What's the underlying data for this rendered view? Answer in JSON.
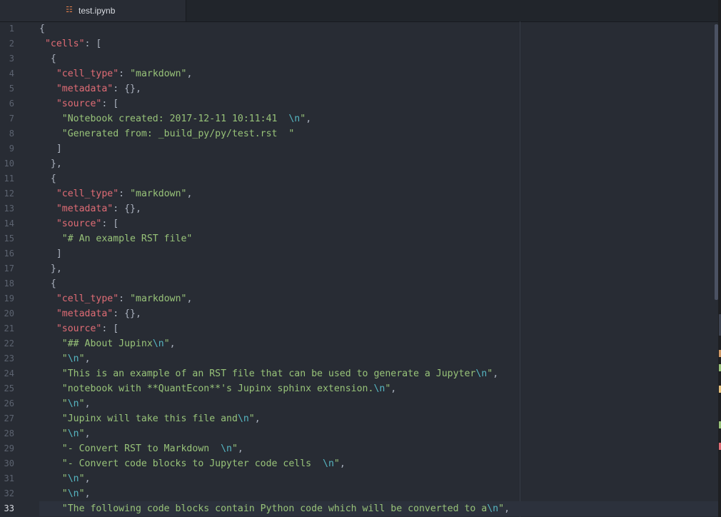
{
  "tab": {
    "title": "test.ipynb",
    "icon": "notebook-file-icon"
  },
  "current_line": 33,
  "lines": [
    {
      "n": "1",
      "tokens": [
        {
          "t": "{",
          "c": "p"
        }
      ]
    },
    {
      "n": "2",
      "tokens": [
        {
          "t": " ",
          "c": "p"
        },
        {
          "t": "\"cells\"",
          "c": "k"
        },
        {
          "t": ": [",
          "c": "p"
        }
      ]
    },
    {
      "n": "3",
      "tokens": [
        {
          "t": "  {",
          "c": "p"
        }
      ]
    },
    {
      "n": "4",
      "tokens": [
        {
          "t": "   ",
          "c": "p"
        },
        {
          "t": "\"cell_type\"",
          "c": "k"
        },
        {
          "t": ": ",
          "c": "p"
        },
        {
          "t": "\"markdown\"",
          "c": "s"
        },
        {
          "t": ",",
          "c": "p"
        }
      ]
    },
    {
      "n": "5",
      "tokens": [
        {
          "t": "   ",
          "c": "p"
        },
        {
          "t": "\"metadata\"",
          "c": "k"
        },
        {
          "t": ": {},",
          "c": "p"
        }
      ]
    },
    {
      "n": "6",
      "tokens": [
        {
          "t": "   ",
          "c": "p"
        },
        {
          "t": "\"source\"",
          "c": "k"
        },
        {
          "t": ": [",
          "c": "p"
        }
      ]
    },
    {
      "n": "7",
      "tokens": [
        {
          "t": "    ",
          "c": "p"
        },
        {
          "t": "\"Notebook created: 2017-12-11 10:11:41  ",
          "c": "s"
        },
        {
          "t": "\\n",
          "c": "e"
        },
        {
          "t": "\"",
          "c": "s"
        },
        {
          "t": ",",
          "c": "p"
        }
      ]
    },
    {
      "n": "8",
      "tokens": [
        {
          "t": "    ",
          "c": "p"
        },
        {
          "t": "\"Generated from: _build_py/py/test.rst  \"",
          "c": "s"
        }
      ]
    },
    {
      "n": "9",
      "tokens": [
        {
          "t": "   ]",
          "c": "p"
        }
      ]
    },
    {
      "n": "10",
      "tokens": [
        {
          "t": "  },",
          "c": "p"
        }
      ]
    },
    {
      "n": "11",
      "tokens": [
        {
          "t": "  {",
          "c": "p"
        }
      ]
    },
    {
      "n": "12",
      "tokens": [
        {
          "t": "   ",
          "c": "p"
        },
        {
          "t": "\"cell_type\"",
          "c": "k"
        },
        {
          "t": ": ",
          "c": "p"
        },
        {
          "t": "\"markdown\"",
          "c": "s"
        },
        {
          "t": ",",
          "c": "p"
        }
      ]
    },
    {
      "n": "13",
      "tokens": [
        {
          "t": "   ",
          "c": "p"
        },
        {
          "t": "\"metadata\"",
          "c": "k"
        },
        {
          "t": ": {},",
          "c": "p"
        }
      ]
    },
    {
      "n": "14",
      "tokens": [
        {
          "t": "   ",
          "c": "p"
        },
        {
          "t": "\"source\"",
          "c": "k"
        },
        {
          "t": ": [",
          "c": "p"
        }
      ]
    },
    {
      "n": "15",
      "tokens": [
        {
          "t": "    ",
          "c": "p"
        },
        {
          "t": "\"# An example RST file\"",
          "c": "s"
        }
      ]
    },
    {
      "n": "16",
      "tokens": [
        {
          "t": "   ]",
          "c": "p"
        }
      ]
    },
    {
      "n": "17",
      "tokens": [
        {
          "t": "  },",
          "c": "p"
        }
      ]
    },
    {
      "n": "18",
      "tokens": [
        {
          "t": "  {",
          "c": "p"
        }
      ]
    },
    {
      "n": "19",
      "tokens": [
        {
          "t": "   ",
          "c": "p"
        },
        {
          "t": "\"cell_type\"",
          "c": "k"
        },
        {
          "t": ": ",
          "c": "p"
        },
        {
          "t": "\"markdown\"",
          "c": "s"
        },
        {
          "t": ",",
          "c": "p"
        }
      ]
    },
    {
      "n": "20",
      "tokens": [
        {
          "t": "   ",
          "c": "p"
        },
        {
          "t": "\"metadata\"",
          "c": "k"
        },
        {
          "t": ": {},",
          "c": "p"
        }
      ]
    },
    {
      "n": "21",
      "tokens": [
        {
          "t": "   ",
          "c": "p"
        },
        {
          "t": "\"source\"",
          "c": "k"
        },
        {
          "t": ": [",
          "c": "p"
        }
      ]
    },
    {
      "n": "22",
      "tokens": [
        {
          "t": "    ",
          "c": "p"
        },
        {
          "t": "\"## About Jupinx",
          "c": "s"
        },
        {
          "t": "\\n",
          "c": "e"
        },
        {
          "t": "\"",
          "c": "s"
        },
        {
          "t": ",",
          "c": "p"
        }
      ]
    },
    {
      "n": "23",
      "tokens": [
        {
          "t": "    ",
          "c": "p"
        },
        {
          "t": "\"",
          "c": "s"
        },
        {
          "t": "\\n",
          "c": "e"
        },
        {
          "t": "\"",
          "c": "s"
        },
        {
          "t": ",",
          "c": "p"
        }
      ]
    },
    {
      "n": "24",
      "tokens": [
        {
          "t": "    ",
          "c": "p"
        },
        {
          "t": "\"This is an example of an RST file that can be used to generate a Jupyter",
          "c": "s"
        },
        {
          "t": "\\n",
          "c": "e"
        },
        {
          "t": "\"",
          "c": "s"
        },
        {
          "t": ",",
          "c": "p"
        }
      ]
    },
    {
      "n": "25",
      "tokens": [
        {
          "t": "    ",
          "c": "p"
        },
        {
          "t": "\"notebook with **QuantEcon**'s Jupinx sphinx extension.",
          "c": "s"
        },
        {
          "t": "\\n",
          "c": "e"
        },
        {
          "t": "\"",
          "c": "s"
        },
        {
          "t": ",",
          "c": "p"
        }
      ]
    },
    {
      "n": "26",
      "tokens": [
        {
          "t": "    ",
          "c": "p"
        },
        {
          "t": "\"",
          "c": "s"
        },
        {
          "t": "\\n",
          "c": "e"
        },
        {
          "t": "\"",
          "c": "s"
        },
        {
          "t": ",",
          "c": "p"
        }
      ]
    },
    {
      "n": "27",
      "tokens": [
        {
          "t": "    ",
          "c": "p"
        },
        {
          "t": "\"Jupinx will take this file and",
          "c": "s"
        },
        {
          "t": "\\n",
          "c": "e"
        },
        {
          "t": "\"",
          "c": "s"
        },
        {
          "t": ",",
          "c": "p"
        }
      ]
    },
    {
      "n": "28",
      "tokens": [
        {
          "t": "    ",
          "c": "p"
        },
        {
          "t": "\"",
          "c": "s"
        },
        {
          "t": "\\n",
          "c": "e"
        },
        {
          "t": "\"",
          "c": "s"
        },
        {
          "t": ",",
          "c": "p"
        }
      ]
    },
    {
      "n": "29",
      "tokens": [
        {
          "t": "    ",
          "c": "p"
        },
        {
          "t": "\"- Convert RST to Markdown  ",
          "c": "s"
        },
        {
          "t": "\\n",
          "c": "e"
        },
        {
          "t": "\"",
          "c": "s"
        },
        {
          "t": ",",
          "c": "p"
        }
      ]
    },
    {
      "n": "30",
      "tokens": [
        {
          "t": "    ",
          "c": "p"
        },
        {
          "t": "\"- Convert code blocks to Jupyter code cells  ",
          "c": "s"
        },
        {
          "t": "\\n",
          "c": "e"
        },
        {
          "t": "\"",
          "c": "s"
        },
        {
          "t": ",",
          "c": "p"
        }
      ]
    },
    {
      "n": "31",
      "tokens": [
        {
          "t": "    ",
          "c": "p"
        },
        {
          "t": "\"",
          "c": "s"
        },
        {
          "t": "\\n",
          "c": "e"
        },
        {
          "t": "\"",
          "c": "s"
        },
        {
          "t": ",",
          "c": "p"
        }
      ]
    },
    {
      "n": "32",
      "tokens": [
        {
          "t": "    ",
          "c": "p"
        },
        {
          "t": "\"",
          "c": "s"
        },
        {
          "t": "\\n",
          "c": "e"
        },
        {
          "t": "\"",
          "c": "s"
        },
        {
          "t": ",",
          "c": "p"
        }
      ]
    },
    {
      "n": "33",
      "tokens": [
        {
          "t": "    ",
          "c": "p"
        },
        {
          "t": "\"The following code blocks contain Python code which will be converted to a",
          "c": "s"
        },
        {
          "t": "\\n",
          "c": "e"
        },
        {
          "t": "\"",
          "c": "s"
        },
        {
          "t": ",",
          "c": "p"
        }
      ]
    }
  ],
  "colors": {
    "editor_bg": "#282c34",
    "key": "#e06c75",
    "string": "#98c379",
    "escape": "#56b6c2",
    "punctuation": "#abb2bf",
    "line_number": "#5c6370"
  }
}
